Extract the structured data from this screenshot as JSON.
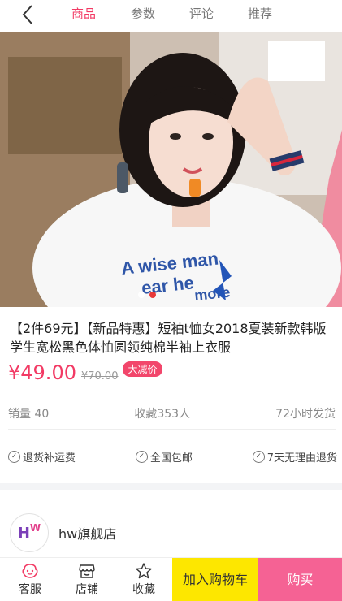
{
  "header": {
    "back_icon": "chevron-left-icon",
    "tabs": [
      {
        "label": "商品",
        "active": true
      },
      {
        "label": "参数",
        "active": false
      },
      {
        "label": "评论",
        "active": false
      },
      {
        "label": "推荐",
        "active": false
      }
    ]
  },
  "gallery": {
    "shirt_print": [
      "A wise man",
      "ear he",
      "more"
    ],
    "slide_count": 2,
    "active_slide": 2
  },
  "product": {
    "title": "【2件69元】【新品特惠】短袖t恤女2018夏装新款韩版学生宽松黑色体恤圆领纯棉半袖上衣服",
    "price": "¥49.00",
    "old_price": "¥70.00",
    "badge": "大减价",
    "accent_color": "#f23a64"
  },
  "stats": {
    "sales": "销量 40",
    "favorites": "收藏353人",
    "shipping": "72小时发货"
  },
  "guarantees": [
    {
      "label": "退货补运费"
    },
    {
      "label": "全国包邮"
    },
    {
      "label": "7天无理由退货"
    }
  ],
  "shop": {
    "logo_text": "HW",
    "name": "hw旗舰店"
  },
  "bottom_bar": {
    "service": {
      "label": "客服",
      "icon": "service-face-icon"
    },
    "store": {
      "label": "店铺",
      "icon": "store-icon"
    },
    "favorite": {
      "label": "收藏",
      "icon": "star-icon"
    },
    "add_to_cart": "加入购物车",
    "buy_now": "购买",
    "cart_color": "#fde700",
    "buy_color": "#f56294"
  }
}
